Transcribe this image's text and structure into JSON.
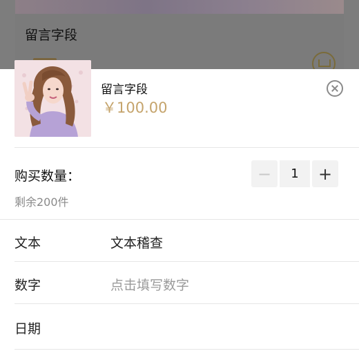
{
  "background_page": {
    "title": "留言字段"
  },
  "sheet": {
    "product": {
      "name": "留言字段",
      "price": "￥100.00"
    },
    "quantity": {
      "label": "购买数量：",
      "value": "1",
      "decrement_symbol": "−",
      "increment_symbol": "+",
      "stock": "剩余200件"
    },
    "form": [
      {
        "label": "文本",
        "value": "文本稽查",
        "placeholder": ""
      },
      {
        "label": "数字",
        "value": "",
        "placeholder": "点击填写数字"
      },
      {
        "label": "日期",
        "value": "",
        "placeholder": ""
      }
    ]
  },
  "colors": {
    "price": "#c5a46c",
    "overlay": "#7d7d7d",
    "placeholder": "#9a9a9a"
  },
  "icons": [
    "close-circle-icon",
    "shopping-cart-icon"
  ]
}
